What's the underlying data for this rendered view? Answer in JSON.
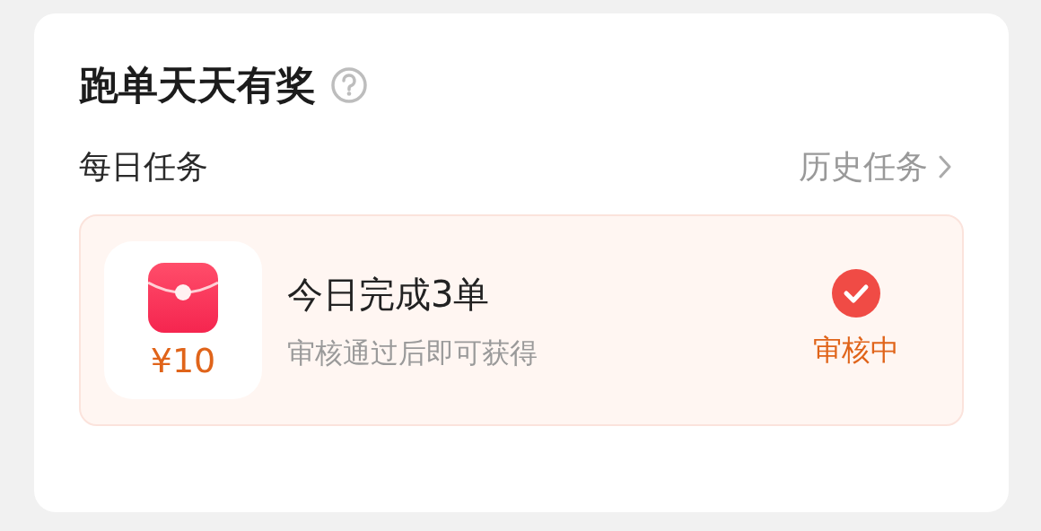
{
  "title": "跑单天天有奖",
  "section": {
    "label": "每日任务",
    "link": "历史任务"
  },
  "tasks": [
    {
      "reward": "¥10",
      "name": "今日完成3单",
      "description": "审核通过后即可获得",
      "status": {
        "label": "审核中",
        "checked": true
      }
    }
  ]
}
